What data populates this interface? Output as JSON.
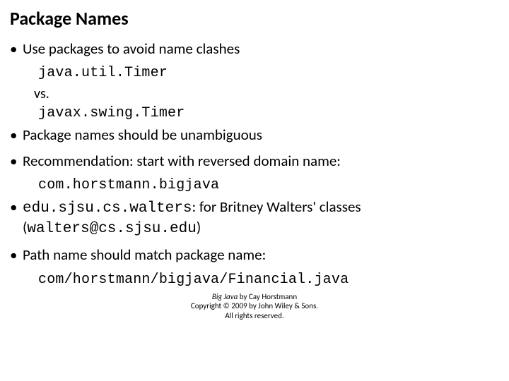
{
  "title": "Package Names",
  "bullets": {
    "b1": "Use packages to avoid name clashes",
    "code1": "java.util.Timer",
    "vs": "vs.",
    "code2": "javax.swing.Timer",
    "b2": "Package names should be unambiguous",
    "b3": "Recommendation: start with reversed domain name:",
    "code3": "com.horstmann.bigjava",
    "b4_code": "edu.sjsu.cs.walters",
    "b4_text": ": for Britney Walters' classes",
    "b4_paren_open": "(",
    "b4_email": "walters@cs.sjsu.edu",
    "b4_paren_close": ")",
    "b5": "Path name should match package name:",
    "code5": "com/horstmann/bigjava/Financial.java"
  },
  "footer": {
    "book": "Big Java",
    "byline": " by Cay Horstmann",
    "copyright": "Copyright © 2009 by John Wiley & Sons.",
    "rights": "All rights reserved."
  }
}
